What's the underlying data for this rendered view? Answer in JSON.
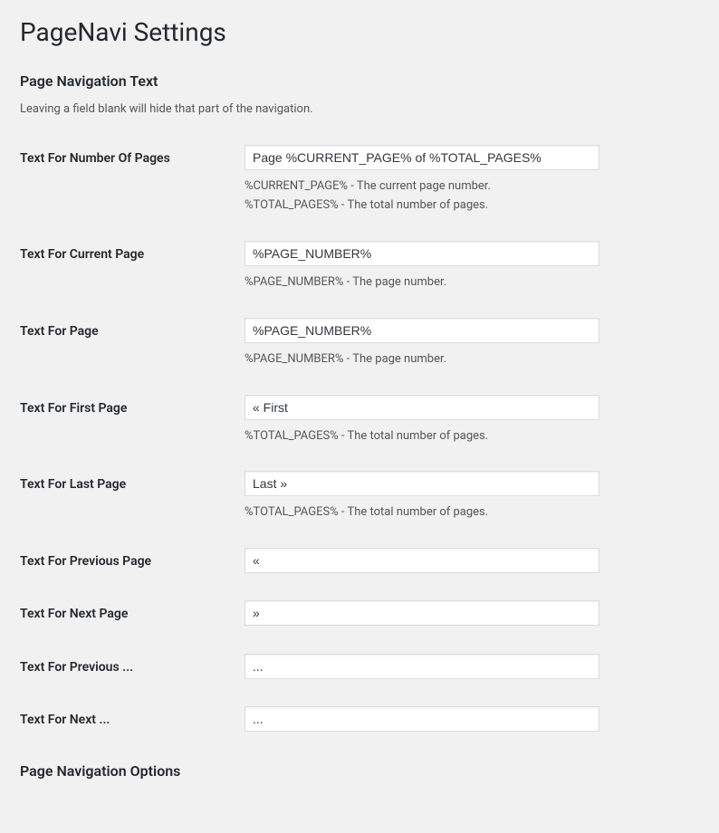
{
  "page_title": "PageNavi Settings",
  "section1": {
    "heading": "Page Navigation Text",
    "description": "Leaving a field blank will hide that part of the navigation.",
    "fields": {
      "number_of_pages": {
        "label": "Text For Number Of Pages",
        "value": "Page %CURRENT_PAGE% of %TOTAL_PAGES%",
        "help1": "%CURRENT_PAGE% - The current page number.",
        "help2": "%TOTAL_PAGES% - The total number of pages."
      },
      "current_page": {
        "label": "Text For Current Page",
        "value": "%PAGE_NUMBER%",
        "help1": "%PAGE_NUMBER% - The page number."
      },
      "page": {
        "label": "Text For Page",
        "value": "%PAGE_NUMBER%",
        "help1": "%PAGE_NUMBER% - The page number."
      },
      "first_page": {
        "label": "Text For First Page",
        "value": "« First",
        "help1": "%TOTAL_PAGES% - The total number of pages."
      },
      "last_page": {
        "label": "Text For Last Page",
        "value": "Last »",
        "help1": "%TOTAL_PAGES% - The total number of pages."
      },
      "previous_page": {
        "label": "Text For Previous Page",
        "value": "«"
      },
      "next_page": {
        "label": "Text For Next Page",
        "value": "»"
      },
      "previous_ellipsis": {
        "label": "Text For Previous ...",
        "value": "..."
      },
      "next_ellipsis": {
        "label": "Text For Next ...",
        "value": "..."
      }
    }
  },
  "section2": {
    "heading": "Page Navigation Options"
  }
}
